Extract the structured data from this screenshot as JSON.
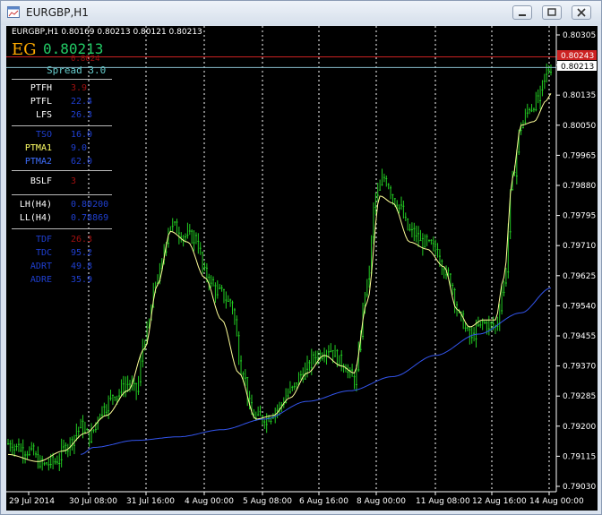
{
  "window": {
    "title": "EURGBP,H1"
  },
  "header": {
    "symbol_line": "EURGBP,H1  0.80169 0.80213 0.80121 0.80213"
  },
  "panel": {
    "eg": "EG",
    "price": "0.80213",
    "sub_price": "0.8024",
    "spread": "Spread 3.0",
    "rows": [
      {
        "label": "PTFH",
        "value": "3.9",
        "label_color": "#ffffff",
        "value_color": "#a01010"
      },
      {
        "label": "PTFL",
        "value": "22.4",
        "label_color": "#ffffff",
        "value_color": "#1f3fd0"
      },
      {
        "label": "LFS",
        "value": "26.3",
        "label_color": "#ffffff",
        "value_color": "#1f3fd0"
      },
      {
        "label": "TSO",
        "value": "16.0",
        "label_color": "#1f3fd0",
        "value_color": "#1f3fd0"
      },
      {
        "label": "PTMA1",
        "value": "9.0",
        "label_color": "#ffff66",
        "value_color": "#1f3fd0"
      },
      {
        "label": "PTMA2",
        "value": "62.0",
        "label_color": "#3f6fff",
        "value_color": "#1f3fd0"
      },
      {
        "label": "BSLF",
        "value": "3",
        "label_color": "#ffffff",
        "value_color": "#a01010"
      },
      {
        "label": "LH(H4)",
        "value": "0.80200",
        "label_color": "#ffffff",
        "value_color": "#1f3fd0"
      },
      {
        "label": "LL(H4)",
        "value": "0.78869",
        "label_color": "#ffffff",
        "value_color": "#1f3fd0"
      },
      {
        "label": "TDF",
        "value": "26.3",
        "label_color": "#1f3fd0",
        "value_color": "#a01010"
      },
      {
        "label": "TDC",
        "value": "95.2",
        "label_color": "#1f3fd0",
        "value_color": "#1f3fd0"
      },
      {
        "label": "ADRT",
        "value": "49.8",
        "label_color": "#1f3fd0",
        "value_color": "#1f3fd0"
      },
      {
        "label": "ADRE",
        "value": "35.9",
        "label_color": "#1f3fd0",
        "value_color": "#1f3fd0"
      }
    ]
  },
  "price_tags": {
    "ask": "0.80243",
    "bid": "0.80213"
  },
  "colors": {
    "candles": "#22cc22",
    "ma_fast": "#ffff99",
    "ma_slow": "#3355ee",
    "ask_line": "#cc2222",
    "bid_line": "#88bbcc"
  },
  "chart_data": {
    "type": "candlestick",
    "ylim": [
      0.7903,
      0.80305
    ],
    "y_ticks": [
      "0.80305",
      "0.80220",
      "0.80135",
      "0.80050",
      "0.79965",
      "0.79880",
      "0.79795",
      "0.79710",
      "0.79625",
      "0.79540",
      "0.79455",
      "0.79370",
      "0.79285",
      "0.79200",
      "0.79115",
      "0.79030"
    ],
    "x_ticks": [
      "29 Jul 2014",
      "30 Jul 08:00",
      "31 Jul 16:00",
      "4 Aug 00:00",
      "5 Aug 08:00",
      "6 Aug 16:00",
      "8 Aug 00:00",
      "11 Aug 08:00",
      "12 Aug 16:00",
      "14 Aug 00:00"
    ],
    "ask_price": 0.80243,
    "bid_price": 0.80213,
    "series": [
      {
        "name": "close",
        "anchors": [
          [
            0,
            0.7915
          ],
          [
            10,
            0.7913
          ],
          [
            16,
            0.7909
          ],
          [
            22,
            0.791
          ],
          [
            28,
            0.7915
          ],
          [
            34,
            0.792
          ],
          [
            38,
            0.7917
          ],
          [
            44,
            0.7925
          ],
          [
            50,
            0.7929
          ],
          [
            56,
            0.7932
          ],
          [
            60,
            0.793
          ],
          [
            64,
            0.7945
          ],
          [
            70,
            0.7962
          ],
          [
            76,
            0.7977
          ],
          [
            82,
            0.7974
          ],
          [
            88,
            0.7973
          ],
          [
            92,
            0.7963
          ],
          [
            98,
            0.7958
          ],
          [
            104,
            0.7955
          ],
          [
            110,
            0.7935
          ],
          [
            114,
            0.7923
          ],
          [
            120,
            0.7922
          ],
          [
            126,
            0.7925
          ],
          [
            132,
            0.793
          ],
          [
            138,
            0.7935
          ],
          [
            144,
            0.794
          ],
          [
            150,
            0.7942
          ],
          [
            156,
            0.7938
          ],
          [
            162,
            0.7933
          ],
          [
            168,
            0.796
          ],
          [
            172,
            0.7985
          ],
          [
            176,
            0.799
          ],
          [
            182,
            0.7983
          ],
          [
            188,
            0.7975
          ],
          [
            194,
            0.7972
          ],
          [
            200,
            0.797
          ],
          [
            206,
            0.7962
          ],
          [
            212,
            0.795
          ],
          [
            216,
            0.7945
          ],
          [
            222,
            0.7949
          ],
          [
            228,
            0.7948
          ],
          [
            232,
            0.796
          ],
          [
            236,
            0.799
          ],
          [
            240,
            0.8005
          ],
          [
            244,
            0.801
          ],
          [
            248,
            0.8012
          ],
          [
            252,
            0.802
          ],
          [
            254,
            0.8021
          ]
        ]
      },
      {
        "name": "ma_fast",
        "anchors": [
          [
            0,
            0.7912
          ],
          [
            14,
            0.791
          ],
          [
            26,
            0.7913
          ],
          [
            36,
            0.7918
          ],
          [
            46,
            0.7923
          ],
          [
            56,
            0.793
          ],
          [
            64,
            0.7942
          ],
          [
            70,
            0.796
          ],
          [
            76,
            0.7975
          ],
          [
            84,
            0.7972
          ],
          [
            92,
            0.7962
          ],
          [
            100,
            0.795
          ],
          [
            108,
            0.7935
          ],
          [
            116,
            0.7922
          ],
          [
            124,
            0.7923
          ],
          [
            132,
            0.7928
          ],
          [
            140,
            0.7935
          ],
          [
            148,
            0.794
          ],
          [
            156,
            0.7937
          ],
          [
            162,
            0.7935
          ],
          [
            168,
            0.7955
          ],
          [
            174,
            0.7985
          ],
          [
            180,
            0.7983
          ],
          [
            188,
            0.7972
          ],
          [
            196,
            0.797
          ],
          [
            204,
            0.7965
          ],
          [
            210,
            0.7953
          ],
          [
            216,
            0.7948
          ],
          [
            222,
            0.795
          ],
          [
            228,
            0.795
          ],
          [
            232,
            0.7962
          ],
          [
            236,
            0.799
          ],
          [
            240,
            0.8005
          ],
          [
            246,
            0.8006
          ],
          [
            252,
            0.8012
          ],
          [
            254,
            0.8014
          ]
        ]
      },
      {
        "name": "ma_slow",
        "anchors": [
          [
            34,
            0.7912
          ],
          [
            40,
            0.7914
          ],
          [
            60,
            0.7916
          ],
          [
            80,
            0.7917
          ],
          [
            100,
            0.7919
          ],
          [
            120,
            0.7922
          ],
          [
            140,
            0.7927
          ],
          [
            160,
            0.793
          ],
          [
            180,
            0.7934
          ],
          [
            200,
            0.794
          ],
          [
            220,
            0.7946
          ],
          [
            240,
            0.7952
          ],
          [
            254,
            0.7959
          ]
        ]
      }
    ]
  }
}
